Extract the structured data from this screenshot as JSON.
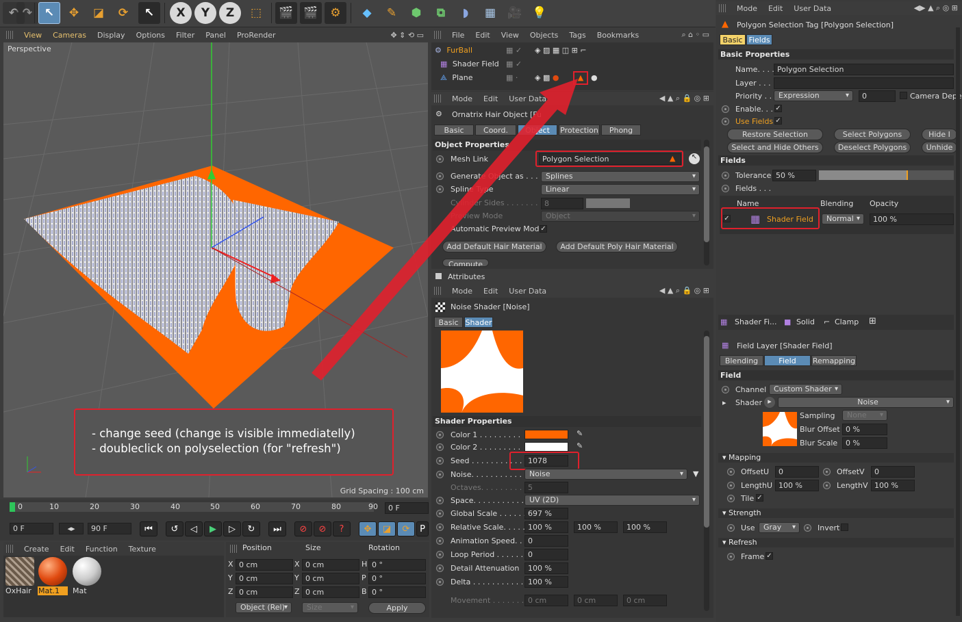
{
  "viewport_menu": {
    "view": "View",
    "cameras": "Cameras",
    "display": "Display",
    "options": "Options",
    "filter": "Filter",
    "panel": "Panel",
    "prorender": "ProRender"
  },
  "viewport": {
    "label": "Perspective",
    "grid_spacing": "Grid Spacing : 100 cm"
  },
  "note": {
    "line1": "- change seed (change is visible immediatelly)",
    "line2": "- doubleclick on polyselection (for \"refresh\")"
  },
  "toolbar": {
    "x": "X",
    "y": "Y",
    "z": "Z"
  },
  "timeline": {
    "ticks": [
      "0",
      "10",
      "20",
      "30",
      "40",
      "50",
      "60",
      "70",
      "80",
      "90"
    ],
    "current_frame": "0 F",
    "start": "0 F",
    "end": "90 F"
  },
  "materials": {
    "menu": {
      "create": "Create",
      "edit": "Edit",
      "function": "Function",
      "texture": "Texture"
    },
    "items": [
      "OxHair",
      "Mat.1",
      "Mat"
    ]
  },
  "coord": {
    "position": "Position",
    "size": "Size",
    "rotation": "Rotation",
    "x": "X",
    "y": "Y",
    "z": "Z",
    "h": "H",
    "p": "P",
    "b": "B",
    "pos_x": "0 cm",
    "pos_y": "0 cm",
    "pos_z": "0 cm",
    "size_x": "0 cm",
    "size_y": "0 cm",
    "size_z": "0 cm",
    "rot_h": "0 °",
    "rot_p": "0 °",
    "rot_b": "0 °",
    "mode": "Object (Rel)",
    "size_mode": "Size",
    "apply": "Apply"
  },
  "object_manager": {
    "menu": {
      "file": "File",
      "edit": "Edit",
      "view": "View",
      "objects": "Objects",
      "tags": "Tags",
      "bookmarks": "Bookmarks"
    },
    "objects": [
      "FurBall",
      "Shader Field",
      "Plane"
    ]
  },
  "attr1": {
    "menu": {
      "mode": "Mode",
      "edit": "Edit",
      "user_data": "User Data"
    },
    "title": "Ornatrix Hair Object [Fu",
    "tabs": [
      "Basic",
      "Coord.",
      "Object",
      "Protection",
      "Phong"
    ],
    "section": "Object Properties",
    "mesh_link_label": "Mesh Link",
    "mesh_link_value": "Polygon Selection",
    "generate_label": "Generate Object as . . . . .",
    "generate_value": "Splines",
    "spline_type_label": "Spline Type",
    "spline_type_value": "Linear",
    "cyl_sides_label": "Cylinder Sides . . . . . . . . .",
    "cyl_sides_value": "8",
    "preview_mode_label": "Preview Mode",
    "preview_mode_value": "Object",
    "auto_preview_label": "Automatic Preview Mode",
    "btn_hair": "Add Default Hair Material",
    "btn_poly": "Add Default Poly Hair Material",
    "btn_compute": "Compute"
  },
  "attributes_title": "Attributes",
  "attr2": {
    "menu": {
      "mode": "Mode",
      "edit": "Edit",
      "user_data": "User Data"
    },
    "title": "Noise Shader [Noise]",
    "tabs": [
      "Basic",
      "Shader"
    ],
    "section": "Shader Properties",
    "color1_label": "Color 1 . . . . . . . . .",
    "color2_label": "Color 2 . . . . . . . . .",
    "seed_label": "Seed . . . . . . . . . . . .",
    "seed_value": "1078",
    "noise_label": "Noise. . . . . . . . . . . .",
    "noise_value": "Noise",
    "octaves_label": "Octaves. . . . . . . . . .",
    "octaves_value": "5",
    "space_label": "Space. . . . . . . . . . . .",
    "space_value": "UV (2D)",
    "global_scale_label": "Global Scale . . . . . . .",
    "global_scale_value": "697 %",
    "relative_scale_label": "Relative Scale. . . . . .",
    "rel1": "100 %",
    "rel2": "100 %",
    "rel3": "100 %",
    "anim_speed_label": "Animation Speed. . . . .",
    "anim_speed_value": "0",
    "loop_period_label": "Loop Period . . . . . . .",
    "loop_period_value": "0",
    "detail_label": "Detail Attenuation",
    "detail_value": "100 %",
    "delta_label": "Delta . . . . . . . . . . . .",
    "delta_value": "100 %",
    "movement_label": "Movement . . . . . . . .",
    "mv1": "0 cm",
    "mv2": "0 cm",
    "mv3": "0 cm",
    "color1": "#ff6600",
    "color2": "#ffffff"
  },
  "right": {
    "menu": {
      "mode": "Mode",
      "edit": "Edit",
      "user_data": "User Data"
    },
    "title": "Polygon Selection Tag [Polygon Selection]",
    "tabs": [
      "Basic",
      "Fields"
    ],
    "section": "Basic Properties",
    "name_label": "Name. . . . .",
    "name_value": "Polygon Selection",
    "layer_label": "Layer . . . . .",
    "priority_label": "Priority . . . .",
    "priority_value": "Expression",
    "priority_num": "0",
    "camera_dep": "Camera Depe",
    "enable_label": "Enable. . .",
    "use_fields_label": "Use Fields",
    "restore": "Restore Selection",
    "select_polys": "Select Polygons",
    "hide": "Hide I",
    "select_hide": "Select and Hide Others",
    "deselect": "Deselect Polygons",
    "unhide": "Unhide",
    "fields_section": "Fields",
    "tolerance_label": "Tolerance",
    "tolerance_value": "50 %",
    "fields_label": "Fields . . .",
    "col_name": "Name",
    "col_blending": "Blending",
    "col_opacity": "Opacity",
    "row_name": "Shader Field",
    "row_blending": "Normal",
    "row_opacity": "100 %",
    "layer_tabs": [
      "Shader Fi...",
      "Solid",
      "Clamp"
    ],
    "field_layer_title": "Field Layer [Shader Field]",
    "fl_tabs": [
      "Blending",
      "Field",
      "Remapping"
    ],
    "field_section": "Field",
    "channel_label": "Channel",
    "channel_value": "Custom Shader",
    "shader_label": "Shader",
    "shader_value": "Noise",
    "sampling_label": "Sampling",
    "sampling_value": "None",
    "blur_offset_label": "Blur Offset",
    "blur_offset_value": "0 %",
    "blur_scale_label": "Blur Scale",
    "blur_scale_value": "0 %",
    "mapping_section": "Mapping",
    "offsetu_label": "OffsetU",
    "offsetu_value": "0",
    "offsetv_label": "OffsetV",
    "offsetv_value": "0",
    "lengthu_label": "LengthU",
    "lengthu_value": "100 %",
    "lengthv_label": "LengthV",
    "lengthv_value": "100 %",
    "tile_label": "Tile",
    "strength_section": "Strength",
    "use_label": "Use",
    "use_value": "Gray",
    "invert_label": "Invert",
    "refresh_section": "Refresh",
    "frame_label": "Frame"
  }
}
